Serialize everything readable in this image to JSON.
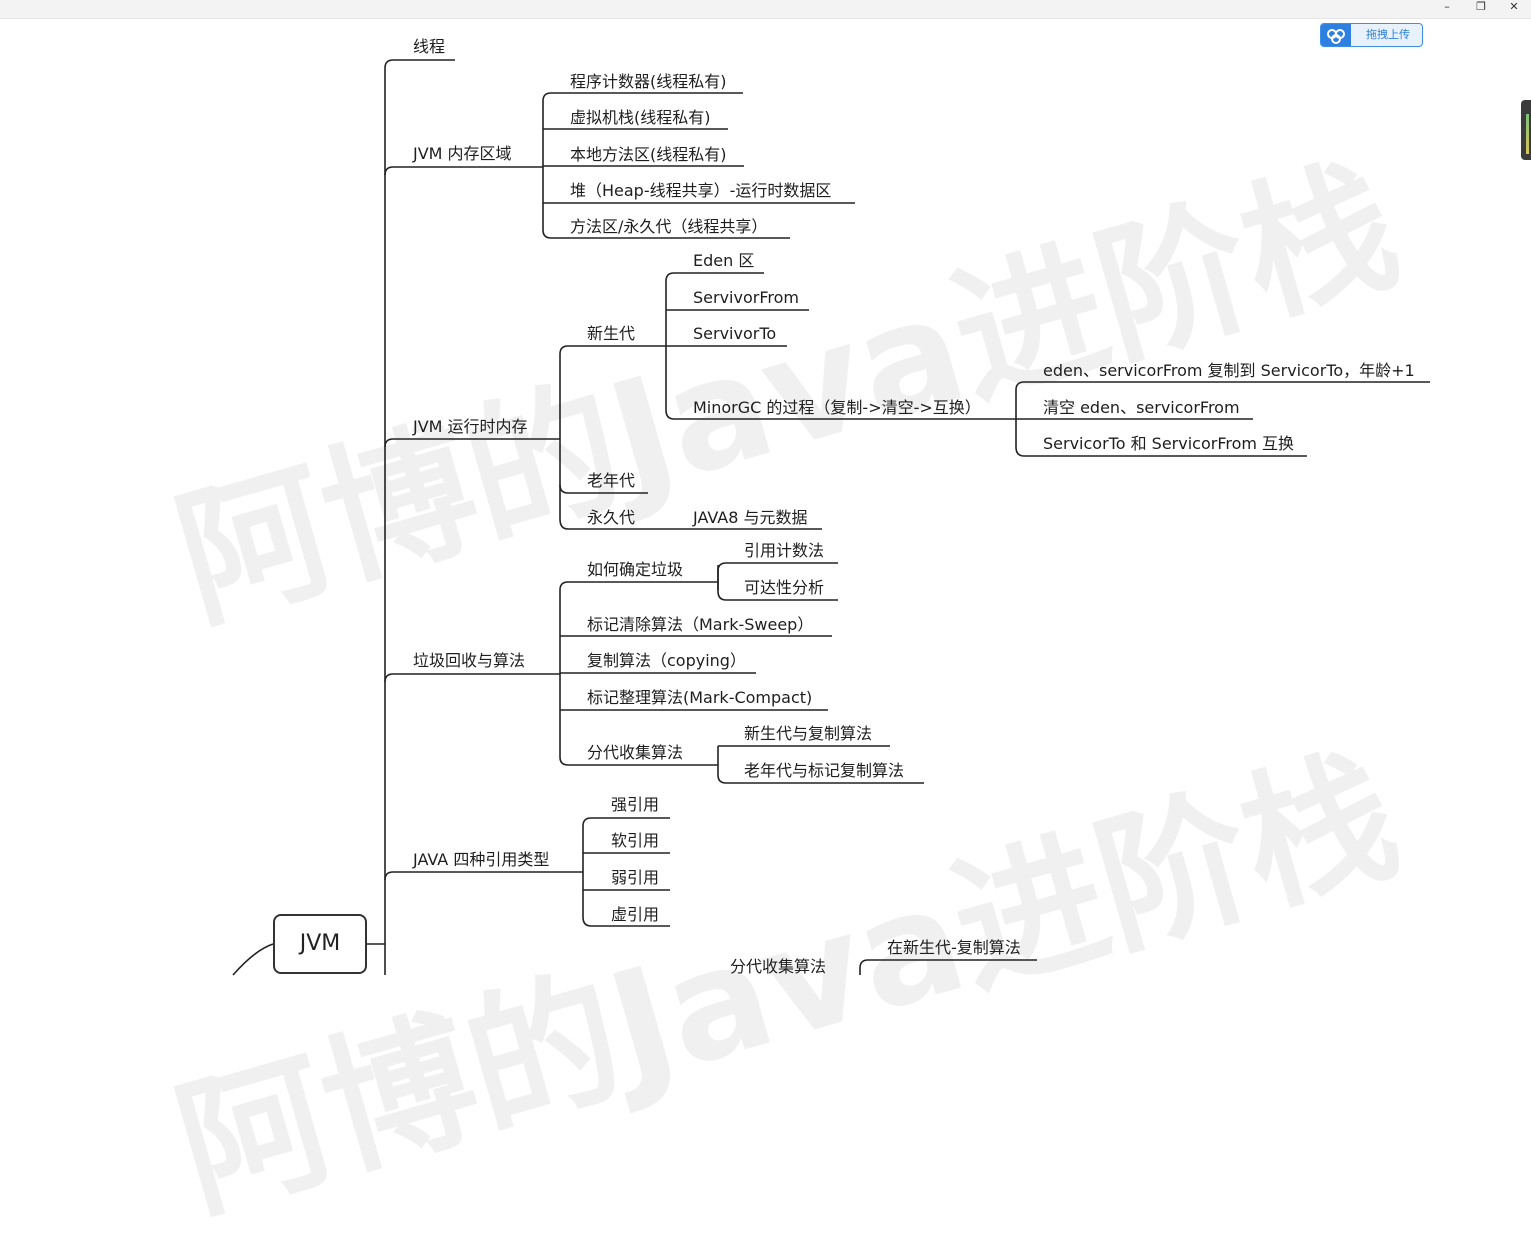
{
  "window": {
    "minimize": "–",
    "restore": "❐",
    "close": "✕"
  },
  "upload_button": {
    "label": "拖拽上传",
    "icon": "cloud-icon"
  },
  "watermark": {
    "line1": "阿博的Java进阶栈",
    "line2": "阿博的Java进阶栈"
  },
  "mindmap": {
    "root": "JVM",
    "nodes": {
      "thread": "线程",
      "mem_area": "JVM 内存区域",
      "pc": "程序计数器(线程私有)",
      "vm_stack": "虚拟机栈(线程私有)",
      "native": "本地方法区(线程私有)",
      "heap": "堆（Heap-线程共享）-运行时数据区",
      "method_area": "方法区/永久代（线程共享）",
      "runtime_mem": "JVM 运行时内存",
      "young": "新生代",
      "eden": "Eden 区",
      "from": "ServivorFrom",
      "to": "ServivorTo",
      "minorgc": "MinorGC 的过程（复制->清空->互换）",
      "gc1": "eden、servicorFrom 复制到 ServicorTo，年龄+1",
      "gc2": "清空 eden、servicorFrom",
      "gc3": "ServicorTo 和 ServicorFrom 互换",
      "old": "老年代",
      "perm": "永久代",
      "java8": "JAVA8 与元数据",
      "gc_algo": "垃圾回收与算法",
      "how": "如何确定垃圾",
      "refcount": "引用计数法",
      "reach": "可达性分析",
      "mark_sweep": "标记清除算法（Mark-Sweep）",
      "copying": "复制算法（copying）",
      "mark_compact": "标记整理算法(Mark-Compact)",
      "gen": "分代收集算法",
      "gen_young": "新生代与复制算法",
      "gen_old": "老年代与标记复制算法",
      "refs": "JAVA 四种引用类型",
      "strong": "强引用",
      "soft": "软引用",
      "weak": "弱引用",
      "phantom": "虚引用",
      "gen2": "分代收集算法",
      "gen2_young": "在新生代-复制算法"
    }
  }
}
